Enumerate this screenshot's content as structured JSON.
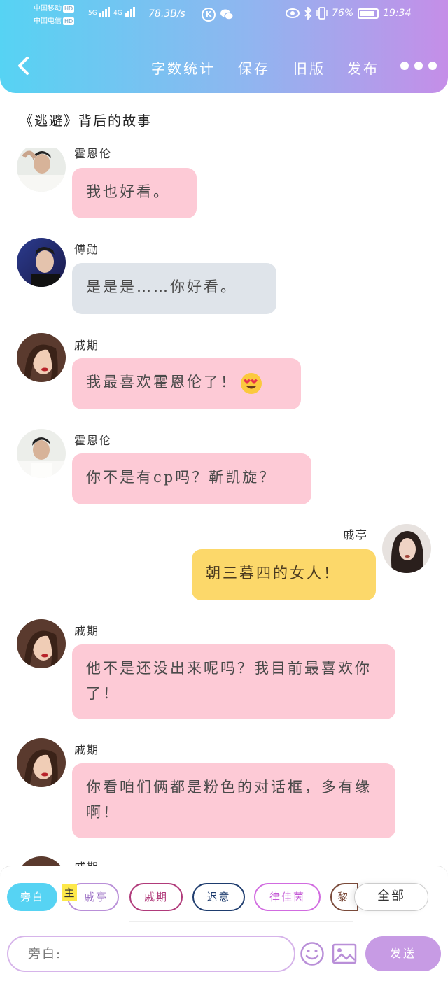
{
  "status_bar": {
    "carrier1": "中国移动",
    "carrier2": "中国电信",
    "hd": "HD",
    "net1": "5G",
    "net2": "4G",
    "speed": "78.3B/s",
    "k_icon": "K",
    "battery_pct": "76%",
    "time": "19:34"
  },
  "nav": {
    "word_count": "字数统计",
    "save": "保存",
    "old_version": "旧版",
    "publish": "发布"
  },
  "title": "《逃避》背后的故事",
  "messages": [
    {
      "sender": "霍恩伦",
      "text": "我也好看。",
      "style": "pink"
    },
    {
      "sender": "傅勋",
      "text": "是是是……你好看。",
      "style": "gray"
    },
    {
      "sender": "戚期",
      "text": "我最喜欢霍恩伦了！",
      "emoji": "heart-eyes",
      "style": "pink"
    },
    {
      "sender": "霍恩伦",
      "text": "你不是有cp吗？靳凯旋？",
      "style": "pink"
    },
    {
      "sender": "戚亭",
      "text": "朝三暮四的女人！",
      "style": "yellow",
      "side": "right"
    },
    {
      "sender": "戚期",
      "text": "他不是还没出来呢吗？我目前最喜欢你了！",
      "style": "pink"
    },
    {
      "sender": "戚期",
      "text": "你看咱们俩都是粉色的对话框，多有缘啊！",
      "style": "pink"
    },
    {
      "sender": "戚期",
      "text": "",
      "style": "partial"
    }
  ],
  "role_chips": {
    "narrator": "旁白",
    "host_badge": "主",
    "c1": "戚亭",
    "c2": "戚期",
    "c3": "迟意",
    "c4": "律佳茵",
    "c5": "黎",
    "all": "全部"
  },
  "composer": {
    "placeholder": "旁白:",
    "send": "发送"
  },
  "colors": {
    "header_gradient": [
      "#56d3f3",
      "#8fb6f0",
      "#c58ee8"
    ],
    "bubble_pink": "#fdcad6",
    "bubble_gray": "#dfe4ea",
    "bubble_yellow": "#fcd86a",
    "send_button": "#c79be4"
  }
}
